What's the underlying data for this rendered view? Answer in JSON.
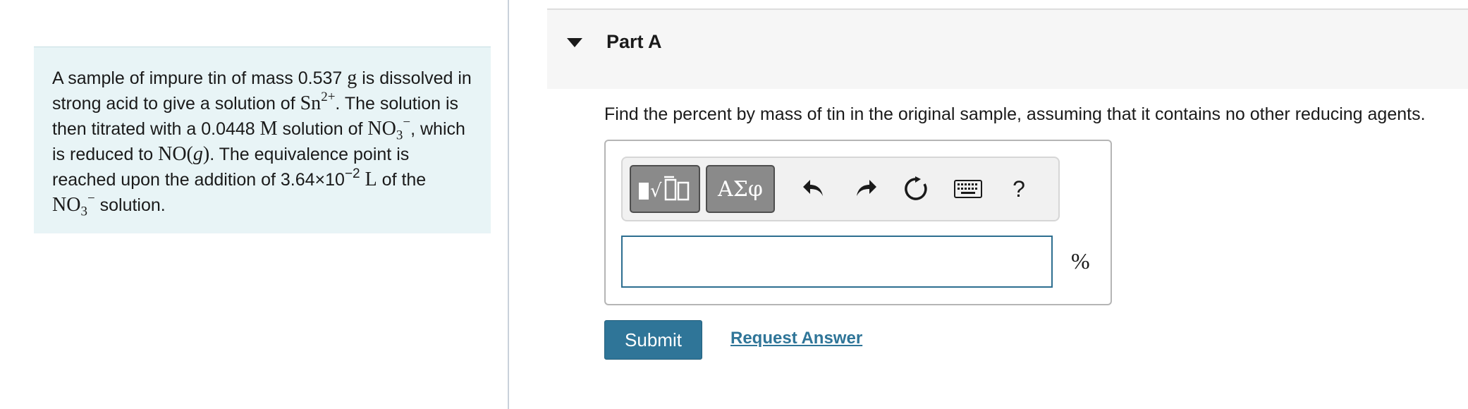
{
  "problem": {
    "p1": "A sample of impure tin of mass 0.537 ",
    "mass_unit": "g",
    "p2": " is dissolved in strong acid to give a solution of ",
    "ion_base": "Sn",
    "ion_charge": "2+",
    "p3": ". The solution is then titrated with a 0.0448 ",
    "conc_unit": "M",
    "p4": " solution of ",
    "nitrate_base": "NO",
    "nitrate_sub": "3",
    "nitrate_charge": "−",
    "p5": ", which is reduced to ",
    "product": "NO(",
    "product_state": "g",
    "product_close": ")",
    "p6": ". The equivalence point is reached upon the addition of 3.64×10",
    "vol_exp": "−2",
    "vol_unit": " L",
    "p7": " of the ",
    "nitrate2_base": "NO",
    "nitrate2_sub": "3",
    "nitrate2_charge": "−",
    "p8": " solution."
  },
  "part": {
    "title": "Part A",
    "question": "Find the percent by mass of tin in the original sample, assuming that it contains no other reducing agents."
  },
  "toolbar": {
    "greek_label": "ΑΣφ",
    "help_label": "?",
    "icons": [
      "templates-icon",
      "greek-symbols-icon",
      "undo-icon",
      "redo-icon",
      "reset-icon",
      "keyboard-icon",
      "help-icon"
    ]
  },
  "answer": {
    "value": "",
    "placeholder": "",
    "unit": "%"
  },
  "actions": {
    "submit_label": "Submit",
    "request_label": "Request Answer"
  },
  "colors": {
    "accent": "#2f7598",
    "problem_bg": "#e8f4f6",
    "toolbar_button": "#8a8a8a"
  }
}
